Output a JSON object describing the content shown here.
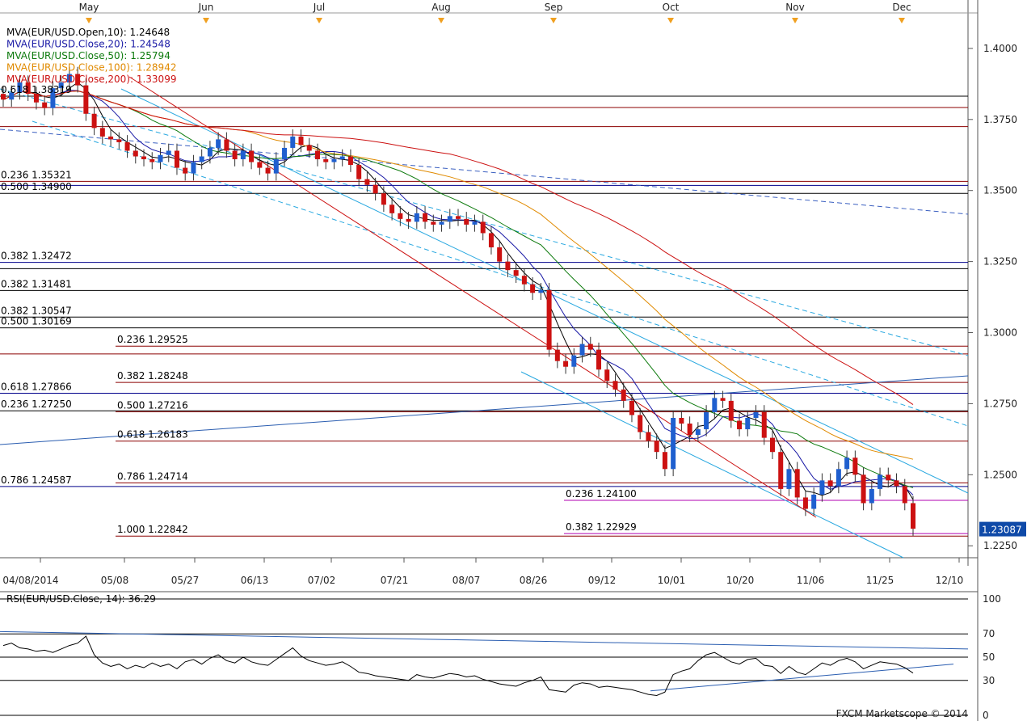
{
  "chart_data": [
    {
      "type": "candlestick",
      "symbol": "EUR/USD",
      "x_labels_top": [
        "May",
        "Jun",
        "Jul",
        "Aug",
        "Sep",
        "Oct",
        "Nov",
        "Dec"
      ],
      "x_labels_bottom": [
        "04/08/2014",
        "05/08",
        "05/27",
        "06/13",
        "07/02",
        "07/21",
        "08/07",
        "08/26",
        "09/12",
        "10/01",
        "10/20",
        "11/06",
        "11/25",
        "12/10"
      ],
      "y_ticks": [
        "1.4000",
        "1.3750",
        "1.3500",
        "1.3250",
        "1.3000",
        "1.2750",
        "1.2500",
        "1.2250"
      ],
      "ylim": [
        1.2208,
        1.4085
      ],
      "last_price": "1.23087",
      "legend": [
        {
          "label": "MVA(EUR/USD.Open,10): 1.24648",
          "color": "#000000"
        },
        {
          "label": "MVA(EUR/USD.Close,20): 1.24548",
          "color": "#1a1aa6"
        },
        {
          "label": "MVA(EUR/USD.Close,50): 1.25794",
          "color": "#0d7a0d"
        },
        {
          "label": "MVA(EUR/USD.Close,100): 1.28942",
          "color": "#e08a00"
        },
        {
          "label": "MVA(EUR/USD.Close,200): 1.33099",
          "color": "#cc1111"
        }
      ],
      "fib_levels": [
        {
          "label": "0.618 1.38319",
          "value": 1.38319,
          "color": "#000000",
          "side": "left"
        },
        {
          "label": "",
          "value": 1.3792,
          "color": "#8b0000",
          "side": "none"
        },
        {
          "label": "",
          "value": 1.3725,
          "color": "#8b0000",
          "side": "none"
        },
        {
          "label": "0.236 1.35321",
          "value": 1.35321,
          "color": "#8b0000",
          "side": "left"
        },
        {
          "label": "",
          "value": 1.3518,
          "color": "#00008b",
          "side": "none"
        },
        {
          "label": "0.500 1.34900",
          "value": 1.349,
          "color": "#000000",
          "side": "left"
        },
        {
          "label": "0.382 1.32472",
          "value": 1.32472,
          "color": "#00008b",
          "side": "left"
        },
        {
          "label": "",
          "value": 1.3225,
          "color": "#000000",
          "side": "none"
        },
        {
          "label": "0.382 1.31481",
          "value": 1.31481,
          "color": "#000000",
          "side": "left"
        },
        {
          "label": "0.382 1.30547",
          "value": 1.30547,
          "color": "#000000",
          "side": "left"
        },
        {
          "label": "0.500 1.30169",
          "value": 1.30169,
          "color": "#000000",
          "side": "left"
        },
        {
          "label": "0.236 1.29525",
          "value": 1.29525,
          "color": "#8b0000",
          "side": "mid"
        },
        {
          "label": "",
          "value": 1.2925,
          "color": "#8b0000",
          "side": "none"
        },
        {
          "label": "0.382 1.28248",
          "value": 1.28248,
          "color": "#8b0000",
          "side": "mid"
        },
        {
          "label": "0.618 1.27866",
          "value": 1.27866,
          "color": "#00008b",
          "side": "left"
        },
        {
          "label": "0.236 1.27250",
          "value": 1.2725,
          "color": "#000000",
          "side": "left"
        },
        {
          "label": "0.500 1.27216",
          "value": 1.27216,
          "color": "#8b0000",
          "side": "mid"
        },
        {
          "label": "0.618 1.26183",
          "value": 1.26183,
          "color": "#8b0000",
          "side": "mid"
        },
        {
          "label": "0.786 1.24587",
          "value": 1.24587,
          "color": "#00008b",
          "side": "left"
        },
        {
          "label": "0.786 1.24714",
          "value": 1.24714,
          "color": "#8b0000",
          "side": "mid"
        },
        {
          "label": "0.236 1.24100",
          "value": 1.241,
          "color": "#b000b0",
          "side": "right"
        },
        {
          "label": "1.000 1.22842",
          "value": 1.22842,
          "color": "#8b0000",
          "side": "mid"
        },
        {
          "label": "0.382 1.22929",
          "value": 1.22929,
          "color": "#b000b0",
          "side": "right"
        }
      ],
      "close_series": [
        1.382,
        1.3845,
        1.388,
        1.384,
        1.381,
        1.379,
        1.386,
        1.388,
        1.391,
        1.387,
        1.377,
        1.372,
        1.369,
        1.368,
        1.367,
        1.364,
        1.362,
        1.361,
        1.36,
        1.3625,
        1.364,
        1.358,
        1.356,
        1.36,
        1.362,
        1.365,
        1.368,
        1.364,
        1.361,
        1.364,
        1.36,
        1.358,
        1.356,
        1.361,
        1.365,
        1.369,
        1.366,
        1.364,
        1.361,
        1.36,
        1.361,
        1.362,
        1.359,
        1.354,
        1.352,
        1.349,
        1.345,
        1.342,
        1.34,
        1.339,
        1.342,
        1.339,
        1.338,
        1.339,
        1.341,
        1.34,
        1.338,
        1.339,
        1.335,
        1.33,
        1.325,
        1.322,
        1.32,
        1.317,
        1.314,
        1.315,
        1.294,
        1.29,
        1.288,
        1.292,
        1.296,
        1.294,
        1.287,
        1.283,
        1.28,
        1.276,
        1.271,
        1.265,
        1.262,
        1.258,
        1.252,
        1.27,
        1.268,
        1.264,
        1.266,
        1.272,
        1.277,
        1.276,
        1.269,
        1.266,
        1.27,
        1.272,
        1.263,
        1.258,
        1.245,
        1.252,
        1.242,
        1.238,
        1.243,
        1.248,
        1.246,
        1.252,
        1.256,
        1.25,
        1.24,
        1.245,
        1.25,
        1.248,
        1.246,
        1.24,
        1.231
      ],
      "rsi": {
        "label": "RSI(EUR/USD.Close, 14): 36.29",
        "ticks": [
          "100",
          "70",
          "50",
          "30",
          "0"
        ],
        "ylim": [
          0,
          100
        ],
        "values": [
          60,
          62,
          58,
          57,
          55,
          56,
          54,
          57,
          60,
          62,
          68,
          52,
          45,
          42,
          44,
          40,
          43,
          41,
          45,
          42,
          44,
          40,
          46,
          48,
          44,
          49,
          52,
          47,
          45,
          50,
          46,
          44,
          43,
          48,
          53,
          58,
          51,
          47,
          45,
          43,
          44,
          46,
          42,
          37,
          36,
          34,
          33,
          32,
          31,
          30,
          35,
          33,
          32,
          34,
          36,
          35,
          33,
          34,
          31,
          29,
          27,
          26,
          25,
          28,
          30,
          33,
          22,
          21,
          20,
          26,
          28,
          27,
          24,
          25,
          24,
          23,
          22,
          20,
          18,
          17,
          20,
          35,
          38,
          40,
          47,
          52,
          54,
          50,
          46,
          44,
          48,
          49,
          43,
          42,
          36,
          42,
          37,
          35,
          40,
          45,
          43,
          47,
          49,
          46,
          40,
          43,
          46,
          45,
          44,
          41,
          36.29
        ]
      },
      "watermark": "FXCM Marketscope © 2014"
    }
  ]
}
